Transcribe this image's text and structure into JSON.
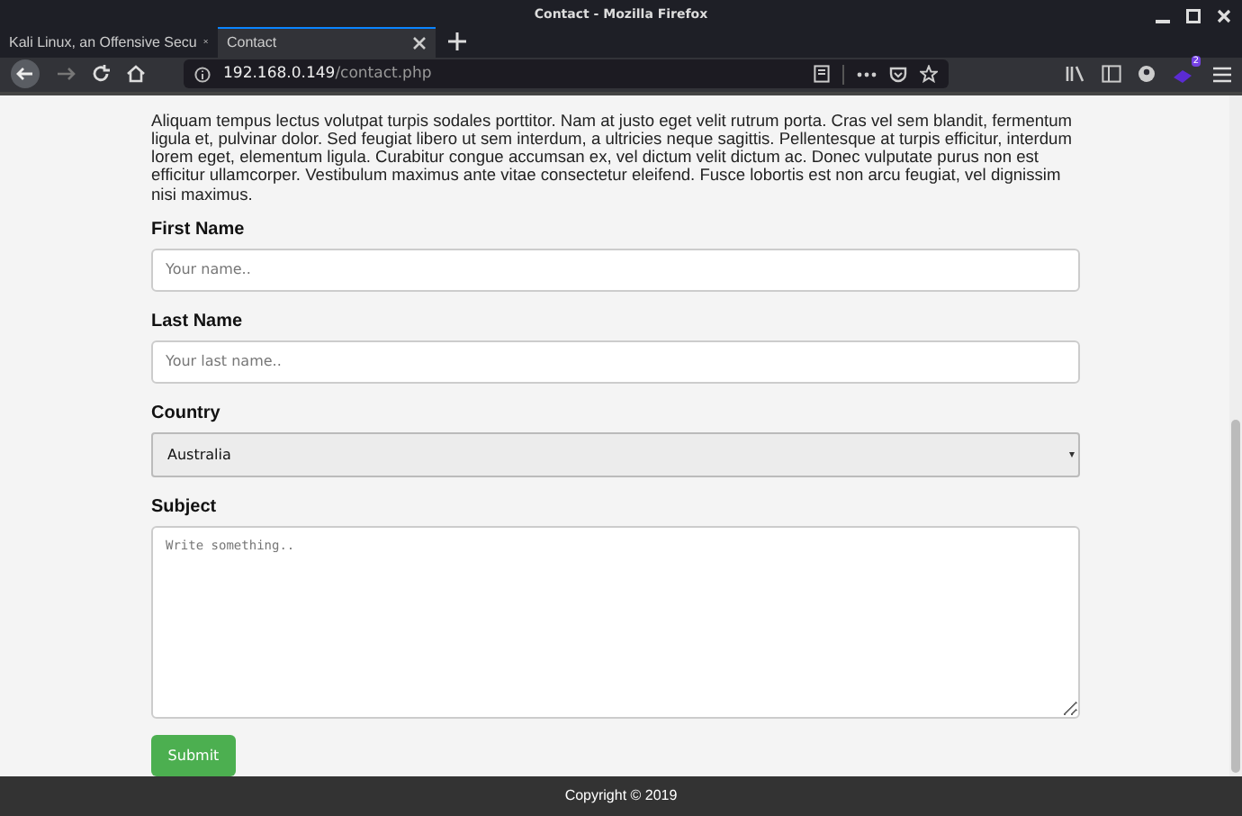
{
  "window": {
    "title": "Contact - Mozilla Firefox"
  },
  "tabs": [
    {
      "label": "Kali Linux, an Offensive Secu",
      "selected": false
    },
    {
      "label": "Contact",
      "selected": true
    }
  ],
  "address": {
    "host": "192.168.0.149",
    "path": "/contact.php"
  },
  "extensions_badge": "2",
  "paragraph": "Aliquam tempus lectus volutpat turpis sodales porttitor. Nam at justo eget velit rutrum porta. Cras vel sem blandit, fermentum ligula et, pulvinar dolor. Sed feugiat libero ut sem interdum, a ultricies neque sagittis. Pellentesque at turpis efficitur, interdum lorem eget, elementum ligula. Curabitur congue accumsan ex, vel dictum velit dictum ac. Donec vulputate purus non est efficitur ullamcorper. Vestibulum maximus ante vitae consectetur eleifend. Fusce lobortis est non arcu feugiat, vel dignissim nisi maximus.",
  "form": {
    "fields": [
      {
        "kind": "text",
        "label": "First Name",
        "placeholder": "Your name.."
      },
      {
        "kind": "text",
        "label": "Last Name",
        "placeholder": "Your last name.."
      },
      {
        "kind": "select",
        "label": "Country",
        "value": "Australia"
      },
      {
        "kind": "textarea",
        "label": "Subject",
        "placeholder": "Write something.."
      }
    ],
    "submit": "Submit"
  },
  "footer": "Copyright © 2019"
}
